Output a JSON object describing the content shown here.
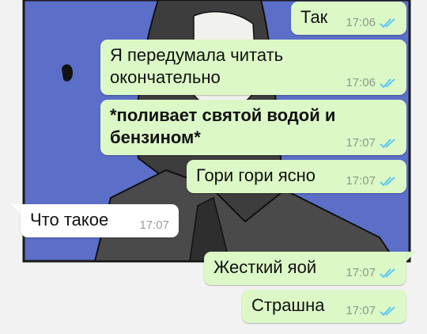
{
  "colors": {
    "outgoing_bubble": "#dcf8c6",
    "incoming_bubble": "#ffffff",
    "read_ticks": "#4fc3f7",
    "wallpaper_blue": "#5b6ec8"
  },
  "messages": [
    {
      "direction": "outgoing",
      "text": "Так",
      "time": "17:06",
      "status_icon": "double-check-read-icon"
    },
    {
      "direction": "outgoing",
      "text": "Я передумала читать\nокончательно",
      "time": "17:06",
      "status_icon": "double-check-read-icon"
    },
    {
      "direction": "outgoing",
      "text": "*поливает святой водой и\nбензином*",
      "time": "17:07",
      "status_icon": "double-check-read-icon",
      "bold": true
    },
    {
      "direction": "outgoing",
      "text": "Гори гори ясно",
      "time": "17:07",
      "status_icon": "double-check-read-icon"
    },
    {
      "direction": "incoming",
      "text": "Что такое",
      "time": "17:07"
    },
    {
      "direction": "outgoing",
      "text": "Жесткий яой",
      "time": "17:07",
      "status_icon": "double-check-read-icon"
    },
    {
      "direction": "outgoing",
      "text": "Страшна",
      "time": "17:07",
      "status_icon": "double-check-read-icon"
    }
  ]
}
